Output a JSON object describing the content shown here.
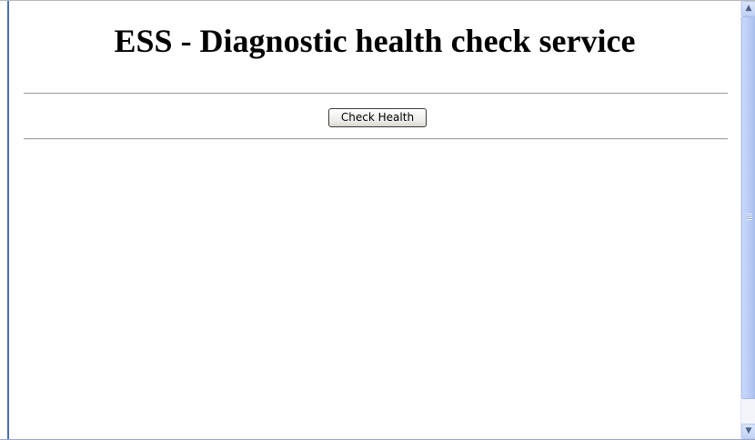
{
  "page": {
    "title": "ESS - Diagnostic health check service"
  },
  "actions": {
    "check_health_label": "Check Health"
  },
  "scrollbar": {
    "up_arrow_icon": "chevron-up-icon",
    "down_arrow_icon": "chevron-down-icon"
  },
  "colors": {
    "frame_accent": "#4a6fb1",
    "rule": "#a0a0a0",
    "scrollbar_thumb": "#b8cbf5"
  }
}
